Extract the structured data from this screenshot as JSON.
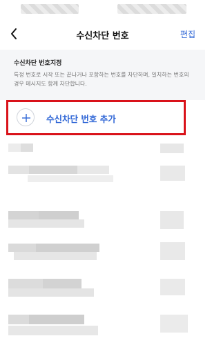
{
  "nav": {
    "title": "수신차단 번호",
    "edit_label": "편집"
  },
  "info": {
    "title": "수신차단 번호지정",
    "description": "특정 번호로 시작 또는 끝나거나 포함하는 번호를 차단하며, 일치하는 번호의 경우 메시지도 함께 차단합니다."
  },
  "add_button": {
    "label": "수신차단 번호 추가"
  },
  "colors": {
    "accent": "#2f66d6",
    "highlight_border": "#d9121a"
  },
  "icons": [
    "back-arrow-icon",
    "plus-icon"
  ]
}
